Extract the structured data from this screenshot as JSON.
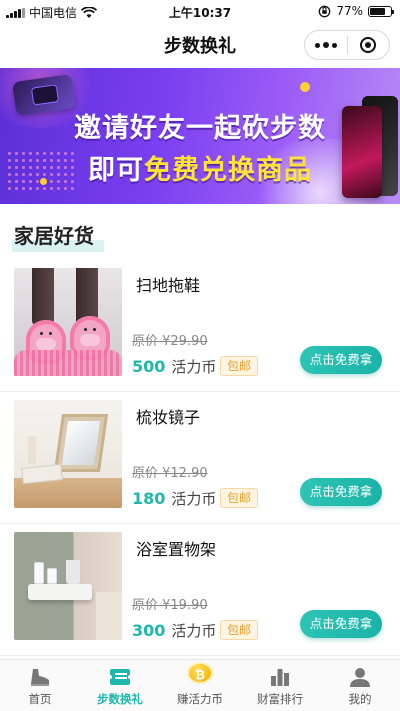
{
  "status_bar": {
    "carrier": "中国电信",
    "time": "上午10:37",
    "battery": "77%",
    "battery_level": 0.77,
    "icons": [
      "signal-icon",
      "wifi-icon",
      "orientation-lock-icon",
      "battery-icon"
    ]
  },
  "nav": {
    "title": "步数换礼",
    "icons": [
      "more-dots-icon",
      "close-target-icon"
    ]
  },
  "banner": {
    "line1": "邀请好友一起砍步数",
    "line2_prefix": "即可",
    "line2_highlight": "免费兑换商品",
    "colors": {
      "start": "#5b2ed6",
      "end": "#b98cf5",
      "highlight": "#ffe23a"
    }
  },
  "section": {
    "title": "家居好货"
  },
  "products": [
    {
      "name": "扫地拖鞋",
      "original_price": "原价 ¥29.90",
      "price": "500",
      "unit": "活力币",
      "tag": "包邮",
      "button": "点击免费拿"
    },
    {
      "name": "梳妆镜子",
      "original_price": "原价 ¥12.90",
      "price": "180",
      "unit": "活力币",
      "tag": "包邮",
      "button": "点击免费拿"
    },
    {
      "name": "浴室置物架",
      "original_price": "原价 ¥19.90",
      "price": "300",
      "unit": "活力币",
      "tag": "包邮",
      "button": "点击免费拿"
    }
  ],
  "tab_bar": {
    "items": [
      {
        "label": "首页",
        "icon": "shoe-icon",
        "active": false
      },
      {
        "label": "步数换礼",
        "icon": "ticket-icon",
        "active": true
      },
      {
        "label": "赚活力币",
        "icon": "coin-icon",
        "active": false
      },
      {
        "label": "财富排行",
        "icon": "bar-chart-icon",
        "active": false
      },
      {
        "label": "我的",
        "icon": "user-icon",
        "active": false
      }
    ]
  },
  "colors": {
    "accent": "#1fb8ac",
    "tag_text": "#e0a030"
  }
}
